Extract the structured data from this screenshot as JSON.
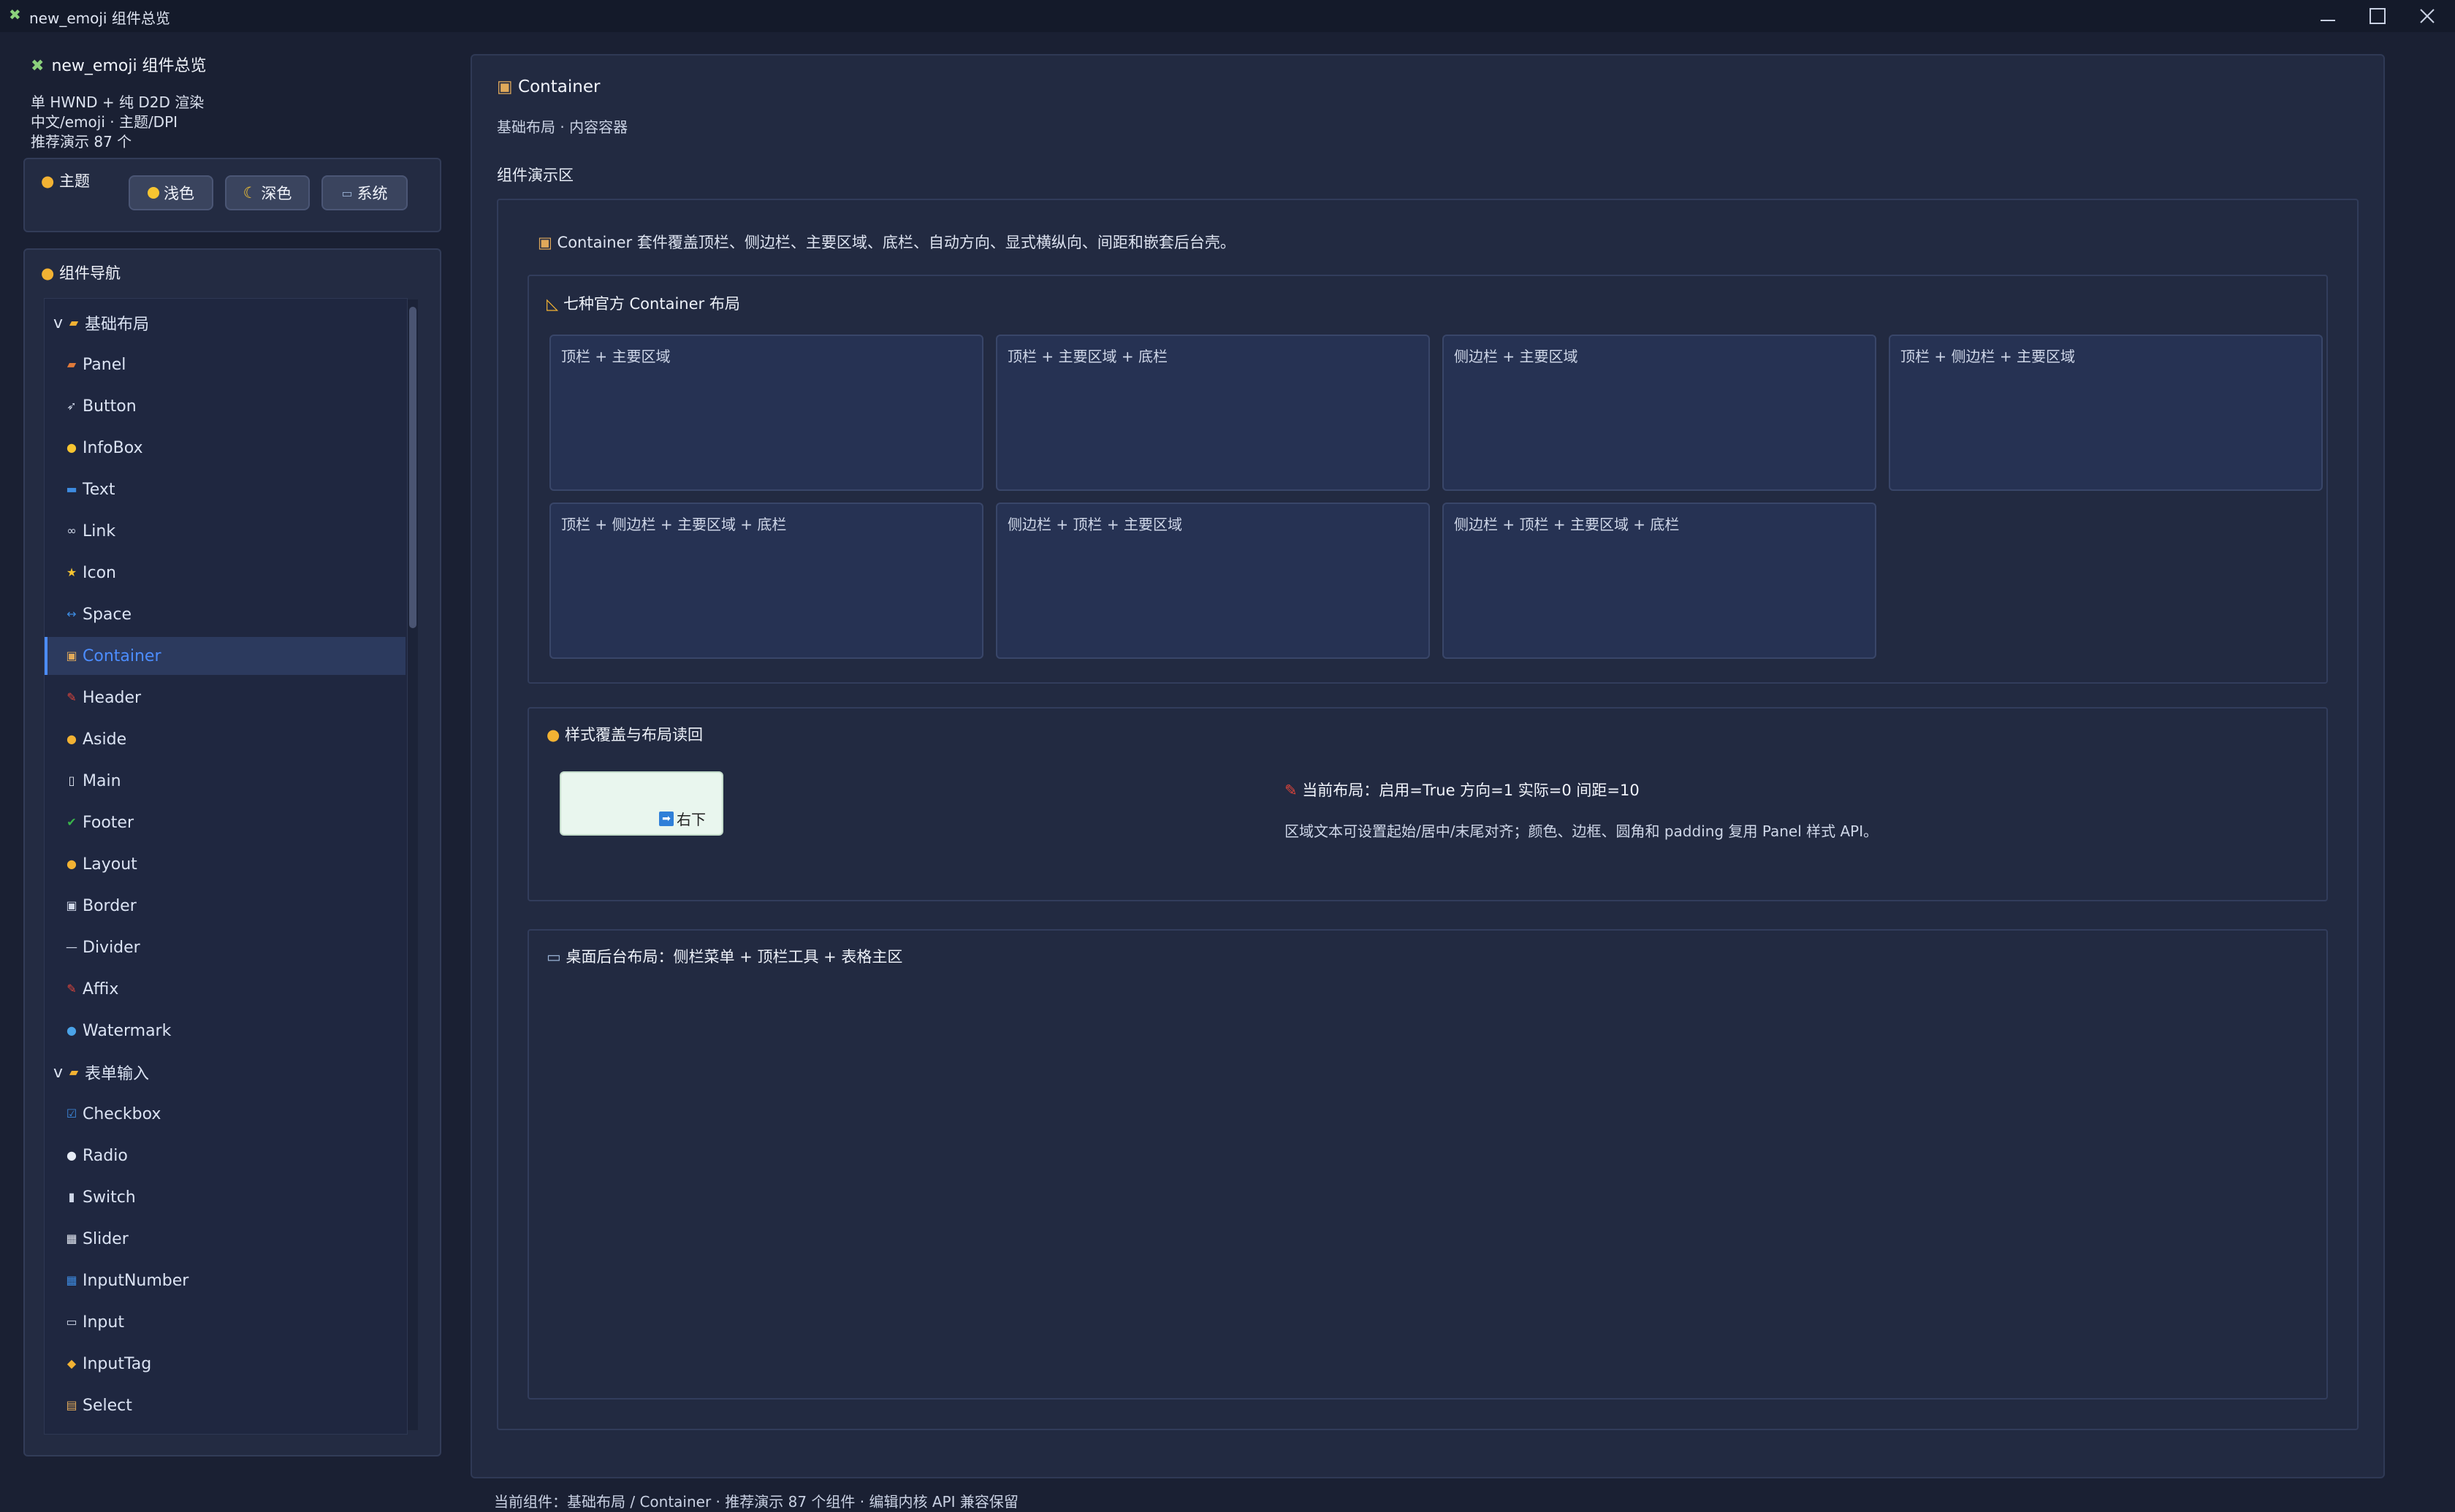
{
  "window": {
    "title": "new_emoji 组件总览"
  },
  "sidebar": {
    "title": "new_emoji 组件总览",
    "info_lines": [
      "单 HWND + 纯 D2D 渲染",
      "中文/emoji · 主题/DPI",
      "推荐演示 87 个"
    ],
    "theme": {
      "label": "主题",
      "buttons": [
        {
          "label": "浅色"
        },
        {
          "label": "深色"
        },
        {
          "label": "系统"
        }
      ]
    },
    "nav": {
      "label": "组件导航",
      "items": [
        {
          "label": "基础布局",
          "group": true
        },
        {
          "label": "Panel"
        },
        {
          "label": "Button"
        },
        {
          "label": "InfoBox"
        },
        {
          "label": "Text"
        },
        {
          "label": "Link"
        },
        {
          "label": "Icon"
        },
        {
          "label": "Space"
        },
        {
          "label": "Container",
          "selected": true
        },
        {
          "label": "Header"
        },
        {
          "label": "Aside"
        },
        {
          "label": "Main"
        },
        {
          "label": "Footer"
        },
        {
          "label": "Layout"
        },
        {
          "label": "Border"
        },
        {
          "label": "Divider"
        },
        {
          "label": "Affix"
        },
        {
          "label": "Watermark"
        },
        {
          "label": "表单输入",
          "group": true
        },
        {
          "label": "Checkbox"
        },
        {
          "label": "Radio"
        },
        {
          "label": "Switch"
        },
        {
          "label": "Slider"
        },
        {
          "label": "InputNumber"
        },
        {
          "label": "Input"
        },
        {
          "label": "InputTag"
        },
        {
          "label": "Select"
        }
      ]
    }
  },
  "main": {
    "title": "Container",
    "subtitle": "基础布局 · 内容容器",
    "demo_label": "组件演示区",
    "intro": "Container 套件覆盖顶栏、侧边栏、主要区域、底栏、自动方向、显式横纵向、间距和嵌套后台壳。",
    "layouts_section": {
      "title": "七种官方 Container 布局",
      "cards": [
        "顶栏 + 主要区域",
        "顶栏 + 主要区域 + 底栏",
        "侧边栏 + 主要区域",
        "顶栏 + 侧边栏 + 主要区域",
        "顶栏 + 侧边栏 + 主要区域 + 底栏",
        "侧边栏 + 顶栏 + 主要区域",
        "侧边栏 + 顶栏 + 主要区域 + 底栏"
      ]
    },
    "style_section": {
      "title": "样式覆盖与布局读回",
      "preview_text": "右下",
      "status": "当前布局：启用=True 方向=1 实际=0 间距=10",
      "desc": "区域文本可设置起始/居中/末尾对齐；颜色、边框、圆角和 padding 复用 Panel 样式 API。"
    },
    "desktop_section": {
      "title": "桌面后台布局：侧栏菜单 + 顶栏工具 + 表格主区"
    }
  },
  "status_bar": {
    "text": "当前组件：基础布局 / Container · 推荐演示 87 个组件 · 编辑内核 API 兼容保留"
  }
}
